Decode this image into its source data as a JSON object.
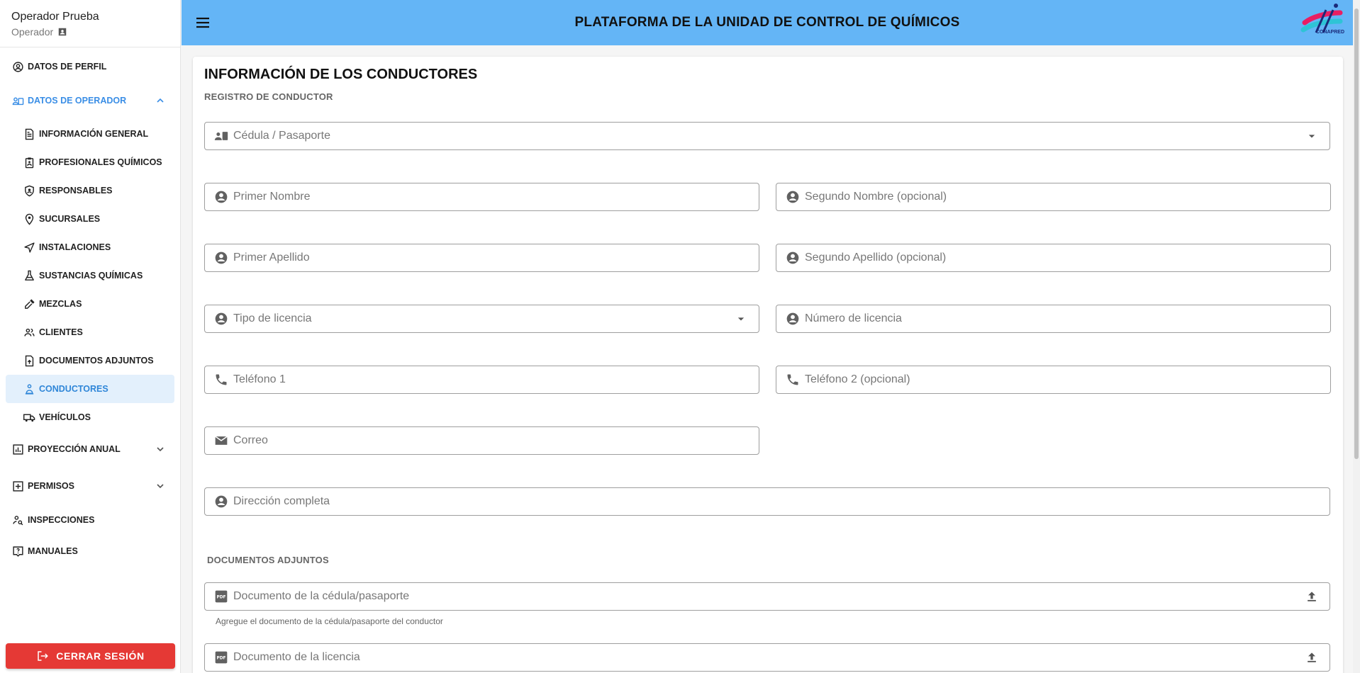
{
  "user": {
    "name": "Operador Prueba",
    "role": "Operador"
  },
  "sidebar": {
    "items": [
      {
        "label": "DATOS DE PERFIL"
      },
      {
        "label": "DATOS DE OPERADOR"
      },
      {
        "label": "INFORMACIÓN GENERAL"
      },
      {
        "label": "PROFESIONALES QUÍMICOS"
      },
      {
        "label": "RESPONSABLES"
      },
      {
        "label": "SUCURSALES"
      },
      {
        "label": "INSTALACIONES"
      },
      {
        "label": "SUSTANCIAS QUÍMICAS"
      },
      {
        "label": "MEZCLAS"
      },
      {
        "label": "CLIENTES"
      },
      {
        "label": "DOCUMENTOS ADJUNTOS"
      },
      {
        "label": "CONDUCTORES"
      },
      {
        "label": "VEHÍCULOS"
      },
      {
        "label": "PROYECCIÓN ANUAL"
      },
      {
        "label": "PERMISOS"
      },
      {
        "label": "INSPECCIONES"
      },
      {
        "label": "MANUALES"
      }
    ],
    "logout_label": "CERRAR SESIÓN"
  },
  "header": {
    "title": "PLATAFORMA DE LA UNIDAD DE CONTROL DE QUÍMICOS",
    "logo_text": "CONAPRED"
  },
  "main": {
    "title": "INFORMACIÓN DE LOS CONDUCTORES",
    "section_register": "REGISTRO DE CONDUCTOR",
    "fields": {
      "cedula": "Cédula / Pasaporte",
      "primer_nombre": "Primer Nombre",
      "segundo_nombre": "Segundo Nombre (opcional)",
      "primer_apellido": "Primer Apellido",
      "segundo_apellido": "Segundo Apellido (opcional)",
      "tipo_licencia": "Tipo de licencia",
      "numero_licencia": "Número de licencia",
      "telefono1": "Teléfono 1",
      "telefono2": "Teléfono 2 (opcional)",
      "correo": "Correo",
      "direccion": "Dirección completa"
    },
    "section_docs": "DOCUMENTOS ADJUNTOS",
    "docs": {
      "cedula_doc": "Documento de la cédula/pasaporte",
      "cedula_hint": "Agregue el documento de la cédula/pasaporte del conductor",
      "licencia_doc": "Documento de la licencia"
    }
  },
  "colors": {
    "header": "#64b5f6",
    "accent": "#3a8ee6",
    "active_bg": "#e3f0fc",
    "logout": "#e53935"
  }
}
